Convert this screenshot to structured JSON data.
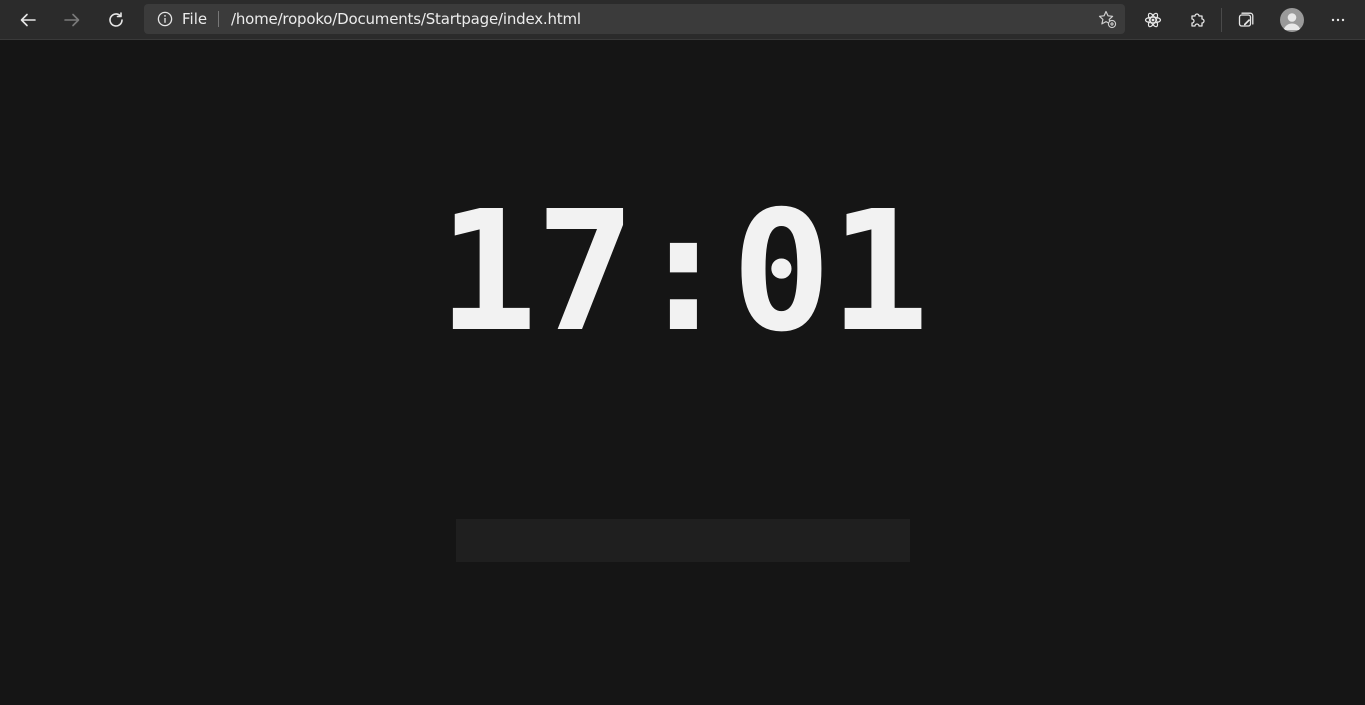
{
  "browser": {
    "scheme_label": "File",
    "url": "/home/ropoko/Documents/Startpage/index.html",
    "nav": {
      "back_icon": "arrow-left-icon",
      "forward_icon": "arrow-right-icon",
      "reload_icon": "reload-icon"
    },
    "toolbar_icons": [
      "favorite-add-icon",
      "react-devtools-icon",
      "extensions-icon",
      "collections-icon",
      "profile-icon",
      "more-icon"
    ]
  },
  "page": {
    "clock": "17:01",
    "search": {
      "value": "",
      "placeholder": ""
    }
  },
  "colors": {
    "background": "#151515",
    "toolbar": "#2b2b2b",
    "address_bar": "#3b3b3b",
    "clock_text": "#f2f2f2",
    "search_box": "#1f1f1f"
  }
}
